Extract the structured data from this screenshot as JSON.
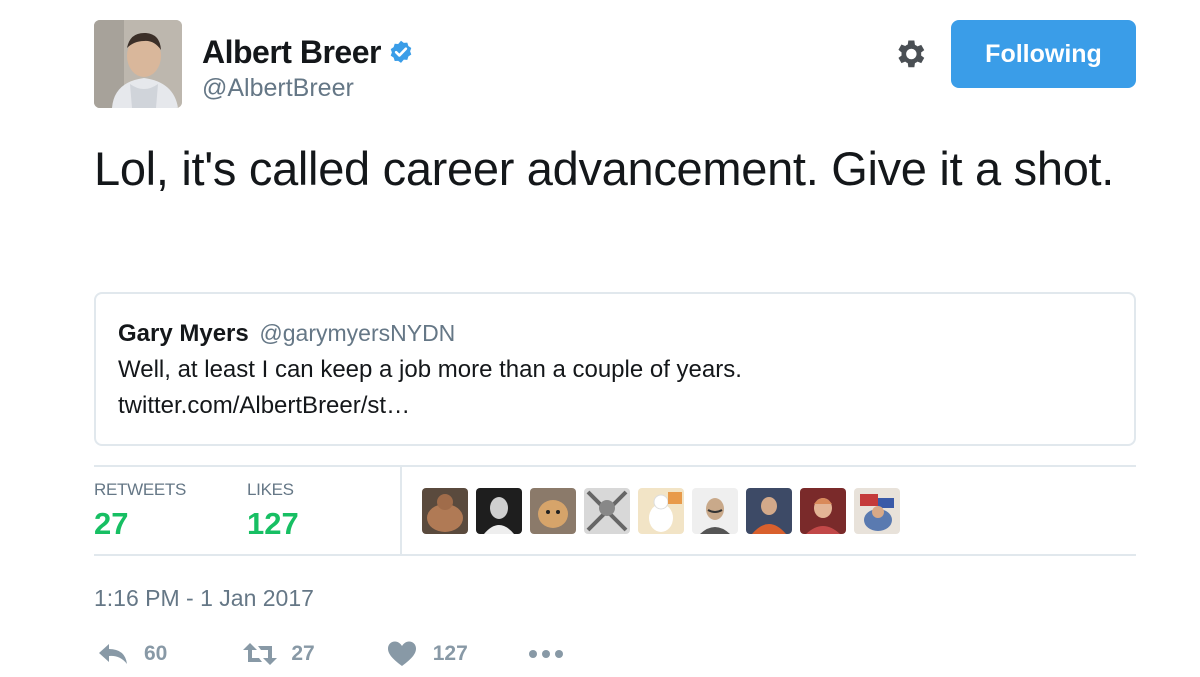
{
  "author": {
    "name": "Albert Breer",
    "handle": "@AlbertBreer",
    "verified": true
  },
  "header": {
    "follow_label": "Following",
    "settings_icon": "gear-icon"
  },
  "tweet": {
    "text": "Lol, it's called career advancement. Give it a shot."
  },
  "quoted_tweet": {
    "name": "Gary Myers",
    "handle": "@garymyersNYDN",
    "text": "Well, at least I can keep a job more than a couple of years.",
    "link": "twitter.com/AlbertBreer/st…"
  },
  "stats": {
    "retweets_label": "RETWEETS",
    "retweets_value": "27",
    "likes_label": "LIKES",
    "likes_value": "127"
  },
  "likers_count_shown": 9,
  "timestamp": "1:16 PM - 1 Jan 2017",
  "actions": {
    "reply_count": "60",
    "retweet_count": "27",
    "like_count": "127"
  },
  "colors": {
    "follow_button": "#3a9de8",
    "stat_value": "#17bf63",
    "verified_badge": "#3a9de8",
    "muted": "#657786"
  }
}
